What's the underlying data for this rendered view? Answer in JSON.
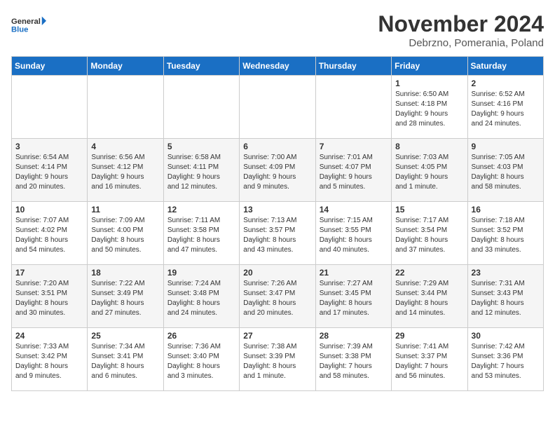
{
  "logo": {
    "line1": "General",
    "line2": "Blue"
  },
  "title": "November 2024",
  "location": "Debrzno, Pomerania, Poland",
  "days_of_week": [
    "Sunday",
    "Monday",
    "Tuesday",
    "Wednesday",
    "Thursday",
    "Friday",
    "Saturday"
  ],
  "weeks": [
    [
      {
        "num": "",
        "info": ""
      },
      {
        "num": "",
        "info": ""
      },
      {
        "num": "",
        "info": ""
      },
      {
        "num": "",
        "info": ""
      },
      {
        "num": "",
        "info": ""
      },
      {
        "num": "1",
        "info": "Sunrise: 6:50 AM\nSunset: 4:18 PM\nDaylight: 9 hours\nand 28 minutes."
      },
      {
        "num": "2",
        "info": "Sunrise: 6:52 AM\nSunset: 4:16 PM\nDaylight: 9 hours\nand 24 minutes."
      }
    ],
    [
      {
        "num": "3",
        "info": "Sunrise: 6:54 AM\nSunset: 4:14 PM\nDaylight: 9 hours\nand 20 minutes."
      },
      {
        "num": "4",
        "info": "Sunrise: 6:56 AM\nSunset: 4:12 PM\nDaylight: 9 hours\nand 16 minutes."
      },
      {
        "num": "5",
        "info": "Sunrise: 6:58 AM\nSunset: 4:11 PM\nDaylight: 9 hours\nand 12 minutes."
      },
      {
        "num": "6",
        "info": "Sunrise: 7:00 AM\nSunset: 4:09 PM\nDaylight: 9 hours\nand 9 minutes."
      },
      {
        "num": "7",
        "info": "Sunrise: 7:01 AM\nSunset: 4:07 PM\nDaylight: 9 hours\nand 5 minutes."
      },
      {
        "num": "8",
        "info": "Sunrise: 7:03 AM\nSunset: 4:05 PM\nDaylight: 9 hours\nand 1 minute."
      },
      {
        "num": "9",
        "info": "Sunrise: 7:05 AM\nSunset: 4:03 PM\nDaylight: 8 hours\nand 58 minutes."
      }
    ],
    [
      {
        "num": "10",
        "info": "Sunrise: 7:07 AM\nSunset: 4:02 PM\nDaylight: 8 hours\nand 54 minutes."
      },
      {
        "num": "11",
        "info": "Sunrise: 7:09 AM\nSunset: 4:00 PM\nDaylight: 8 hours\nand 50 minutes."
      },
      {
        "num": "12",
        "info": "Sunrise: 7:11 AM\nSunset: 3:58 PM\nDaylight: 8 hours\nand 47 minutes."
      },
      {
        "num": "13",
        "info": "Sunrise: 7:13 AM\nSunset: 3:57 PM\nDaylight: 8 hours\nand 43 minutes."
      },
      {
        "num": "14",
        "info": "Sunrise: 7:15 AM\nSunset: 3:55 PM\nDaylight: 8 hours\nand 40 minutes."
      },
      {
        "num": "15",
        "info": "Sunrise: 7:17 AM\nSunset: 3:54 PM\nDaylight: 8 hours\nand 37 minutes."
      },
      {
        "num": "16",
        "info": "Sunrise: 7:18 AM\nSunset: 3:52 PM\nDaylight: 8 hours\nand 33 minutes."
      }
    ],
    [
      {
        "num": "17",
        "info": "Sunrise: 7:20 AM\nSunset: 3:51 PM\nDaylight: 8 hours\nand 30 minutes."
      },
      {
        "num": "18",
        "info": "Sunrise: 7:22 AM\nSunset: 3:49 PM\nDaylight: 8 hours\nand 27 minutes."
      },
      {
        "num": "19",
        "info": "Sunrise: 7:24 AM\nSunset: 3:48 PM\nDaylight: 8 hours\nand 24 minutes."
      },
      {
        "num": "20",
        "info": "Sunrise: 7:26 AM\nSunset: 3:47 PM\nDaylight: 8 hours\nand 20 minutes."
      },
      {
        "num": "21",
        "info": "Sunrise: 7:27 AM\nSunset: 3:45 PM\nDaylight: 8 hours\nand 17 minutes."
      },
      {
        "num": "22",
        "info": "Sunrise: 7:29 AM\nSunset: 3:44 PM\nDaylight: 8 hours\nand 14 minutes."
      },
      {
        "num": "23",
        "info": "Sunrise: 7:31 AM\nSunset: 3:43 PM\nDaylight: 8 hours\nand 12 minutes."
      }
    ],
    [
      {
        "num": "24",
        "info": "Sunrise: 7:33 AM\nSunset: 3:42 PM\nDaylight: 8 hours\nand 9 minutes."
      },
      {
        "num": "25",
        "info": "Sunrise: 7:34 AM\nSunset: 3:41 PM\nDaylight: 8 hours\nand 6 minutes."
      },
      {
        "num": "26",
        "info": "Sunrise: 7:36 AM\nSunset: 3:40 PM\nDaylight: 8 hours\nand 3 minutes."
      },
      {
        "num": "27",
        "info": "Sunrise: 7:38 AM\nSunset: 3:39 PM\nDaylight: 8 hours\nand 1 minute."
      },
      {
        "num": "28",
        "info": "Sunrise: 7:39 AM\nSunset: 3:38 PM\nDaylight: 7 hours\nand 58 minutes."
      },
      {
        "num": "29",
        "info": "Sunrise: 7:41 AM\nSunset: 3:37 PM\nDaylight: 7 hours\nand 56 minutes."
      },
      {
        "num": "30",
        "info": "Sunrise: 7:42 AM\nSunset: 3:36 PM\nDaylight: 7 hours\nand 53 minutes."
      }
    ]
  ]
}
